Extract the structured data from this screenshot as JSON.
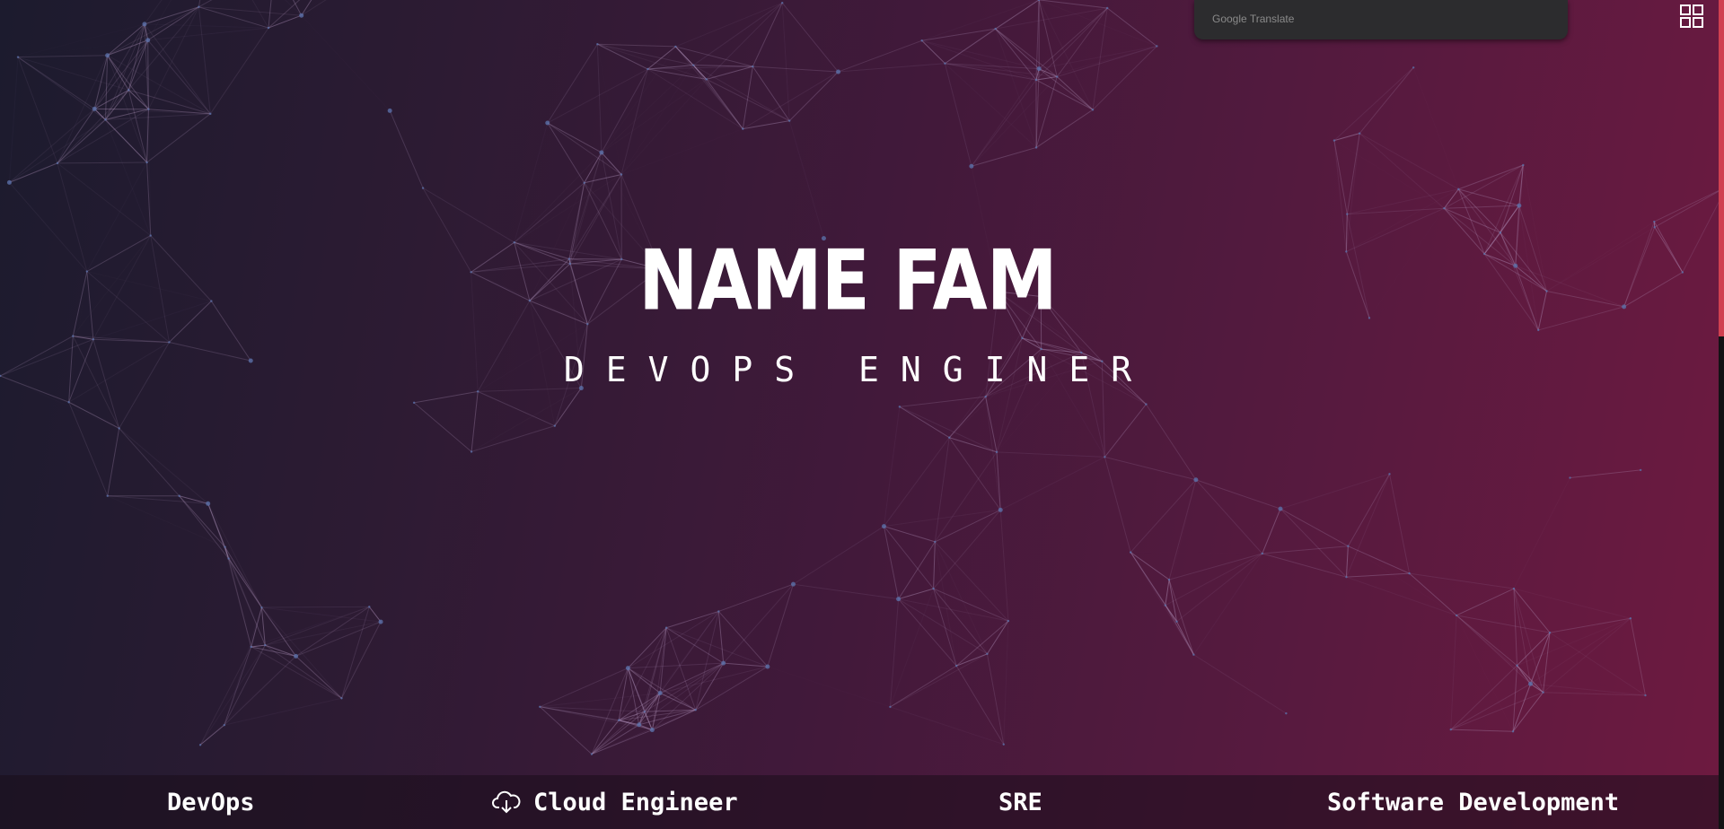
{
  "hero": {
    "name": "NAME FAM",
    "role": "DEVOPS ENGINER"
  },
  "translate": {
    "label": "Google Translate"
  },
  "skills": [
    {
      "label": "DevOps",
      "icon": ""
    },
    {
      "label": "Cloud Engineer",
      "icon": "cloud-download-icon"
    },
    {
      "label": "SRE",
      "icon": ""
    },
    {
      "label": "Software Development",
      "icon": ""
    }
  ],
  "colors": {
    "bg_start": "#1c1b2e",
    "bg_end": "#6e1a40",
    "accent": "#d04050"
  },
  "icons": {
    "apps": "apps-grid-icon"
  }
}
